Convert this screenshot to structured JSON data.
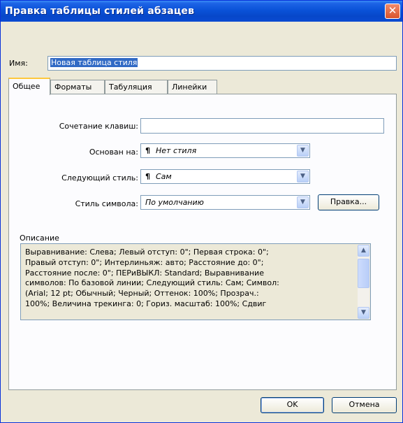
{
  "window": {
    "title": "Правка таблицы стилей абзацев",
    "close_glyph": "✕"
  },
  "name": {
    "label": "Имя:",
    "value": "Новая таблица стиля"
  },
  "tabs": [
    {
      "label": "Общее",
      "active": true
    },
    {
      "label": "Форматы",
      "active": false
    },
    {
      "label": "Табуляция",
      "active": false
    },
    {
      "label": "Линейки",
      "active": false
    }
  ],
  "general": {
    "shortcut_label": "Сочетание клавиш:",
    "shortcut_value": "",
    "based_on_label": "Основан на:",
    "based_on_value": "Нет стиля",
    "next_style_label": "Следующий стиль:",
    "next_style_value": "Сам",
    "char_style_label": "Стиль символа:",
    "char_style_value": "По умолчанию",
    "edit_button": "Правка...",
    "paragraph_icon": "¶"
  },
  "description": {
    "label": "Описание",
    "lines": [
      "Выравнивание: Слева;  Левый отступ: 0\";  Первая строка: 0\";",
      "Правый отступ: 0\";  Интерлиньяж: авто;  Расстояние до: 0\";",
      "Расстояние после: 0\";  ПЕРиВЫКЛ: Standard;  Выравнивание",
      "символов: По базовой линии;  Следующий стиль: Сам;  Символ:",
      "(Arial;  12 pt;  Обычный;  Черный;  Оттенок: 100%;  Прозрач.:",
      "100%;  Величина трекинга: 0;  Гориз. масштаб: 100%;  Сдвиг"
    ]
  },
  "buttons": {
    "ok": "OK",
    "cancel": "Отмена"
  },
  "icons": {
    "dropdown": "chevron-down-icon",
    "scroll_up": "arrow-up-icon",
    "scroll_down": "arrow-down-icon"
  },
  "colors": {
    "titlebar": "#0a52d8",
    "selection": "#316ac5",
    "tab_highlight": "#ffc83c"
  }
}
